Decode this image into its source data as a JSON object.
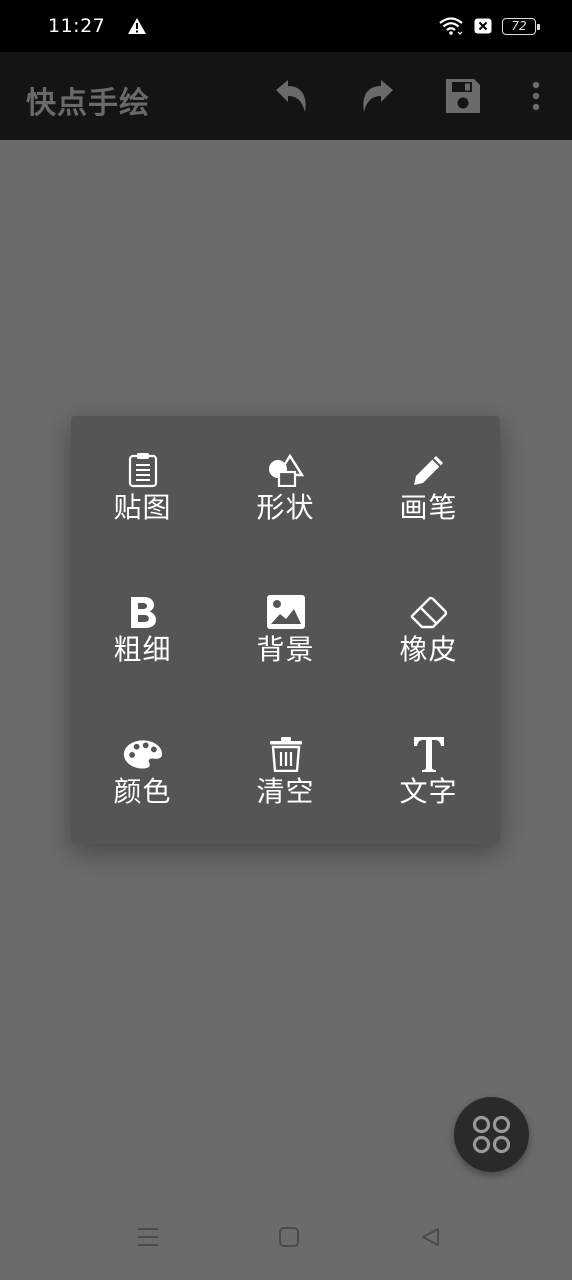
{
  "status_bar": {
    "time": "11:27",
    "battery_level": "72",
    "icons": [
      "warning-icon",
      "wifi-icon",
      "sim-blocked-icon",
      "battery-icon"
    ]
  },
  "app_bar": {
    "title": "快点手绘",
    "actions": [
      "undo-icon",
      "redo-icon",
      "save-icon",
      "more-icon"
    ]
  },
  "menu": {
    "items": [
      {
        "label": "贴图",
        "icon": "clipboard-icon"
      },
      {
        "label": "形状",
        "icon": "shapes-icon"
      },
      {
        "label": "画笔",
        "icon": "pencil-icon"
      },
      {
        "label": "粗细",
        "icon": "bold-icon"
      },
      {
        "label": "背景",
        "icon": "image-icon"
      },
      {
        "label": "橡皮",
        "icon": "eraser-icon"
      },
      {
        "label": "颜色",
        "icon": "palette-icon"
      },
      {
        "label": "清空",
        "icon": "trash-icon"
      },
      {
        "label": "文字",
        "icon": "text-icon"
      }
    ]
  },
  "colors": {
    "canvas": "#6b6b6b",
    "app_bar": "#141414",
    "menu": "#555555",
    "fab": "#2a2a2a"
  }
}
